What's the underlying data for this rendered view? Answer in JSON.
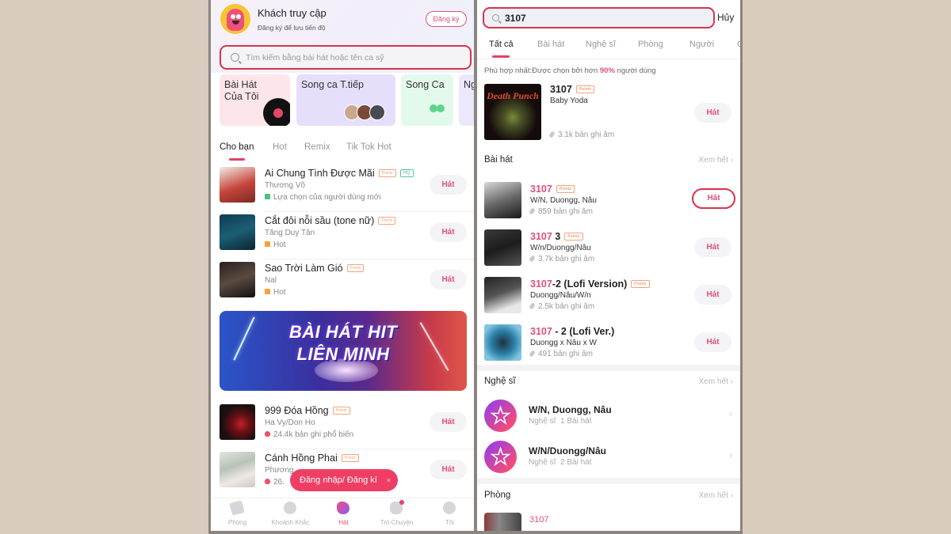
{
  "left": {
    "profile": {
      "name": "Khách truy cập",
      "subtitle": "Đăng ký để lưu tiến độ",
      "register_label": "Đăng ký"
    },
    "search": {
      "placeholder": "Tìm kiếm bằng bài hát hoặc tên ca sỹ"
    },
    "categories": [
      {
        "label": "Bài Hát\nCủa Tôi"
      },
      {
        "label": "Song ca T.tiếp"
      },
      {
        "label": "Song Ca"
      },
      {
        "label": "Ng"
      }
    ],
    "tabs": [
      {
        "label": "Cho bạn",
        "active": true
      },
      {
        "label": "Hot"
      },
      {
        "label": "Remix"
      },
      {
        "label": "Tik Tok Hot"
      }
    ],
    "songs": [
      {
        "title": "Ai Chung Tình Được Mãi",
        "badges": [
          "Points",
          "HQ"
        ],
        "artist": "Thương Võ",
        "meta": "Lựa chọn của người dùng mới",
        "meta_icon": "new-user-icon",
        "action": "Hát"
      },
      {
        "title": "Cắt đôi nỗi sầu (tone nữ)",
        "badges": [
          "Points"
        ],
        "artist": "Tăng Duy Tân",
        "meta": "Hot",
        "meta_icon": "hot-icon",
        "action": "Hát"
      },
      {
        "title": "Sao Trời Làm Gió",
        "badges": [
          "Points"
        ],
        "artist": "Nal",
        "meta": "Hot",
        "meta_icon": "hot-icon",
        "action": "Hát"
      }
    ],
    "banner": {
      "line1": "BÀI HÁT HIT",
      "line2": "LIÊN MINH"
    },
    "songs2": [
      {
        "title": "999 Đóa Hồng",
        "badges": [
          "Points"
        ],
        "artist": "Ha Vy/Don Ho",
        "meta": "24.4k bản ghi phổ biến",
        "meta_icon": "fire-icon",
        "action": "Hát"
      },
      {
        "title": "Cánh Hồng Phai",
        "badges": [
          "Points"
        ],
        "artist": "Phương ...",
        "meta": "26.",
        "meta_icon": "fire-icon",
        "action": "Hát"
      }
    ],
    "toast": {
      "label": "Đăng nhập/ Đăng kí",
      "close": "×"
    },
    "bottom_nav": [
      {
        "label": "Phòng"
      },
      {
        "label": "Khoảnh Khắc"
      },
      {
        "label": "Hát",
        "active": true
      },
      {
        "label": "Trò Chuyện",
        "notification": true
      },
      {
        "label": "Tôi"
      }
    ]
  },
  "right": {
    "search": {
      "value": "3107",
      "cancel_label": "Hủy"
    },
    "tabs": [
      {
        "label": "Tất cả",
        "active": true
      },
      {
        "label": "Bài hát"
      },
      {
        "label": "Nghệ sĩ"
      },
      {
        "label": "Phòng"
      },
      {
        "label": "Người"
      },
      {
        "label": "C"
      }
    ],
    "best_match": {
      "prefix": "Phù hợp nhất:",
      "text1": "Được chọn bởi hơn ",
      "percent": "90%",
      "text2": " người dùng",
      "title": "3107",
      "badge": "Points",
      "artist": "Baby Yoda",
      "cover_text": "Death Punch",
      "recordings": "3.1k bản ghi âm",
      "action": "Hát"
    },
    "songs_section": {
      "title": "Bài hát",
      "see_all": "Xem hết",
      "items": [
        {
          "title_hl": "3107",
          "title_rest": "",
          "badge": "Points",
          "artist": "W/N, Duongg, Nâu",
          "recordings": "859 bản ghi âm",
          "action": "Hát",
          "highlighted": true
        },
        {
          "title_hl": "3107",
          "title_rest": " 3",
          "badge": "Points",
          "artist": "W/n/Duongg/Nâu",
          "recordings": "3.7k bản ghi âm",
          "action": "Hát"
        },
        {
          "title_hl": "3107",
          "title_rest": "-2 (Lofi Version)",
          "badge": "Points",
          "artist": "Duongg/Nâu/W/n",
          "recordings": "2.5k bản ghi âm",
          "action": "Hát"
        },
        {
          "title_hl": "3107",
          "title_rest": " - 2 (Lofi Ver.)",
          "badge": "",
          "artist": "Duongg x Nâu x W",
          "recordings": "491 bản ghi âm",
          "action": "Hát"
        }
      ]
    },
    "artists_section": {
      "title": "Nghệ sĩ",
      "see_all": "Xem hết",
      "items": [
        {
          "name": "W/N, Duongg, Nâu",
          "role": "Nghệ sĩ",
          "count": "1 Bài hát"
        },
        {
          "name": "W/N/Duongg/Nâu",
          "role": "Nghệ sĩ",
          "count": "2 Bài hát"
        }
      ]
    },
    "rooms_section": {
      "title": "Phòng",
      "see_all": "Xem hết",
      "items": [
        {
          "name": "3107"
        }
      ]
    }
  },
  "colors": {
    "accent": "#e0507a",
    "highlight_border": "#d7334d",
    "background": "#d9cbbd"
  }
}
